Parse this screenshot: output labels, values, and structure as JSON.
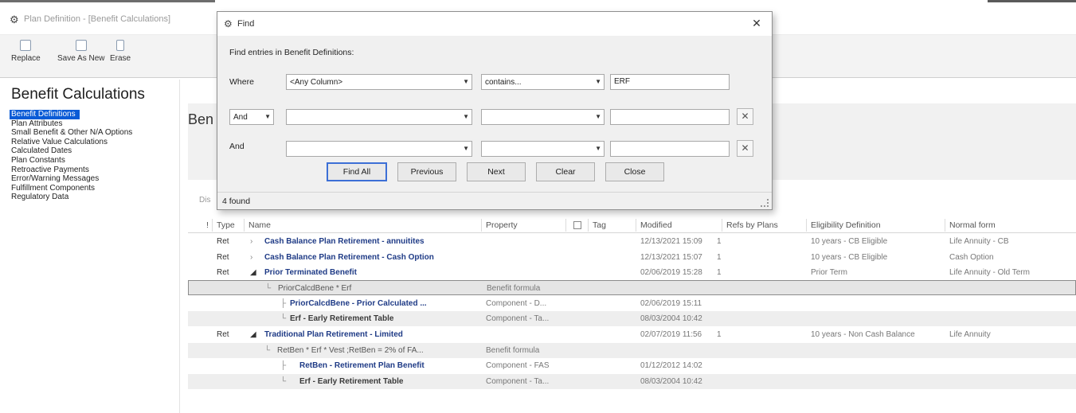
{
  "window": {
    "title": "Plan Definition - [Benefit Calculations]",
    "app_icon": "gear-shield-icon"
  },
  "toolbar": {
    "replace_label": "Replace",
    "save_as_new_label": "Save As New",
    "erase_label": "Erase"
  },
  "sidebar": {
    "heading": "Benefit Calculations",
    "items": [
      "Benefit Definitions",
      "Plan Attributes",
      "Small Benefit & Other N/A Options",
      "Relative Value Calculations",
      "Calculated Dates",
      "Plan Constants",
      "Retroactive Payments",
      "Error/Warning Messages",
      "Fulfillment Components",
      "Regulatory Data"
    ]
  },
  "main": {
    "title_partial": "Ben",
    "desc_partial": "Dis"
  },
  "grid": {
    "columns": [
      "!",
      "Type",
      "Name",
      "Property",
      "Tag",
      "Modified",
      "Refs by Plans",
      "Eligibility Definition",
      "Normal form"
    ],
    "rows": [
      {
        "type": "Ret",
        "name": "Cash Balance Plan Retirement - annuitites",
        "property": "",
        "modified": "12/13/2021 15:09",
        "refs": "1",
        "elig": "10 years - CB Eligible",
        "form": "Life Annuity - CB"
      },
      {
        "type": "Ret",
        "name": "Cash Balance Plan Retirement - Cash Option",
        "property": "",
        "modified": "12/13/2021 15:07",
        "refs": "1",
        "elig": "10 years - CB Eligible",
        "form": "Cash Option"
      },
      {
        "type": "Ret",
        "name": "Prior Terminated Benefit",
        "property": "",
        "modified": "02/06/2019 15:28",
        "refs": "1",
        "elig": "Prior Term",
        "form": "Life Annuity - Old Term"
      },
      {
        "type": "",
        "name": "PriorCalcdBene * Erf",
        "property": "Benefit formula",
        "modified": "",
        "refs": "",
        "elig": "",
        "form": ""
      },
      {
        "type": "",
        "name": "PriorCalcdBene - Prior Calculated ...",
        "property": "Component - D...",
        "modified": "02/06/2019 15:11",
        "refs": "",
        "elig": "",
        "form": ""
      },
      {
        "type": "",
        "name": "Erf - Early Retirement Table",
        "property": "Component - Ta...",
        "modified": "08/03/2004 10:42",
        "refs": "",
        "elig": "",
        "form": ""
      },
      {
        "type": "Ret",
        "name": "Traditional Plan Retirement - Limited",
        "property": "",
        "modified": "02/07/2019 11:56",
        "refs": "1",
        "elig": "10 years - Non Cash Balance",
        "form": "Life Annuity"
      },
      {
        "type": "",
        "name": "RetBen * Erf * Vest   ;RetBen = 2% of FA...",
        "property": "Benefit formula",
        "modified": "",
        "refs": "",
        "elig": "",
        "form": ""
      },
      {
        "type": "",
        "name": "RetBen - Retirement Plan Benefit",
        "property": "Component - FAS",
        "modified": "01/12/2012 14:02",
        "refs": "",
        "elig": "",
        "form": ""
      },
      {
        "type": "",
        "name": "Erf - Early Retirement Table",
        "property": "Component - Ta...",
        "modified": "08/03/2004 10:42",
        "refs": "",
        "elig": "",
        "form": ""
      }
    ]
  },
  "find_dialog": {
    "title": "Find",
    "prompt": "Find entries in Benefit Definitions:",
    "where_label": "Where",
    "row1": {
      "column": "<Any Column>",
      "op": "contains...",
      "value": "ERF"
    },
    "row2": {
      "logic": "And",
      "column": "",
      "op": "",
      "value": ""
    },
    "row3": {
      "logic_label": "And",
      "column": "",
      "op": "",
      "value": ""
    },
    "buttons": {
      "find_all": "Find All",
      "previous": "Previous",
      "next": "Next",
      "clear": "Clear",
      "close": "Close"
    },
    "status": "4 found"
  }
}
